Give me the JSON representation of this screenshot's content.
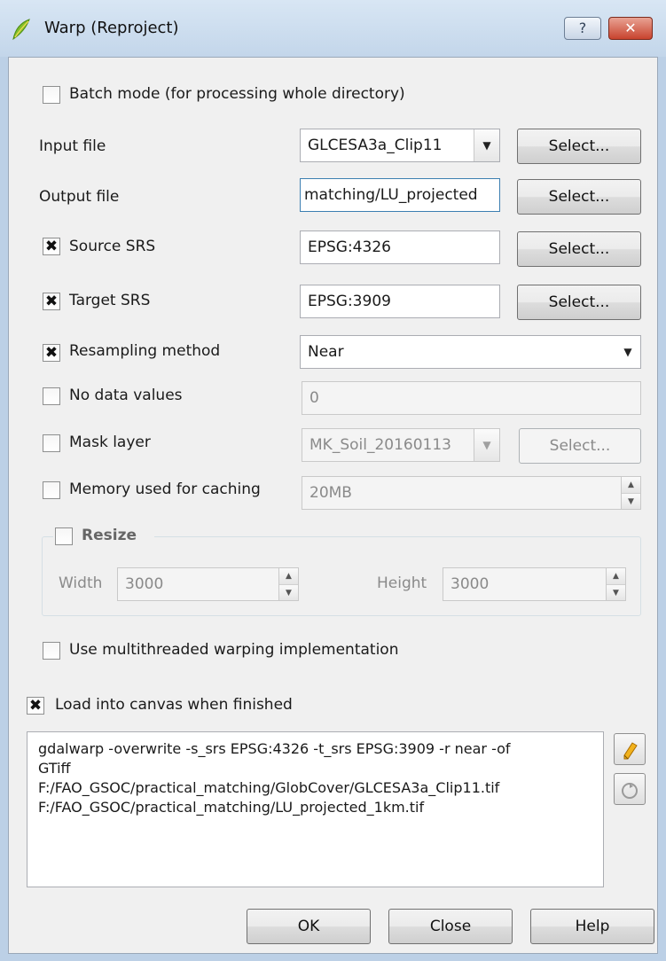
{
  "window": {
    "title": "Warp (Reproject)",
    "help_glyph": "?",
    "close_glyph": "✕"
  },
  "batch_mode": {
    "label": "Batch mode (for processing whole directory)",
    "checked": false
  },
  "input_file": {
    "label": "Input file",
    "value": "GLCESA3a_Clip11",
    "select_label": "Select..."
  },
  "output_file": {
    "label": "Output file",
    "value": "matching/LU_projected",
    "select_label": "Select..."
  },
  "source_srs": {
    "label": "Source SRS",
    "checked": true,
    "value": "EPSG:4326",
    "select_label": "Select..."
  },
  "target_srs": {
    "label": "Target SRS",
    "checked": true,
    "value": "EPSG:3909",
    "select_label": "Select..."
  },
  "resampling": {
    "label": "Resampling method",
    "checked": true,
    "value": "Near"
  },
  "no_data": {
    "label": "No data values",
    "checked": false,
    "value": "0"
  },
  "mask_layer": {
    "label": "Mask layer",
    "checked": false,
    "value": "MK_Soil_20160113",
    "select_label": "Select..."
  },
  "memory": {
    "label": "Memory used for caching",
    "checked": false,
    "value": "20MB"
  },
  "resize": {
    "label": "Resize",
    "checked": false,
    "width_label": "Width",
    "width_value": "3000",
    "height_label": "Height",
    "height_value": "3000"
  },
  "multithreaded": {
    "label": "Use multithreaded warping implementation",
    "checked": false
  },
  "load_canvas": {
    "label": "Load into canvas when finished",
    "checked": true
  },
  "command": {
    "lines": [
      "gdalwarp -overwrite -s_srs EPSG:4326 -t_srs EPSG:3909 -r near -of",
      "GTiff",
      "F:/FAO_GSOC/practical_matching/GlobCover/GLCESA3a_Clip11.tif",
      "F:/FAO_GSOC/practical_matching/LU_projected_1km.tif"
    ]
  },
  "buttons": {
    "ok": "OK",
    "close": "Close",
    "help": "Help"
  },
  "check_glyph": "✖",
  "icons": {
    "edit": "pencil-icon",
    "reset": "reset-icon",
    "app": "qgis-icon"
  },
  "colors": {
    "titlebar": "#c3d6ea",
    "close_button": "#c8432e",
    "dialog_bg": "#f0f0f0"
  }
}
